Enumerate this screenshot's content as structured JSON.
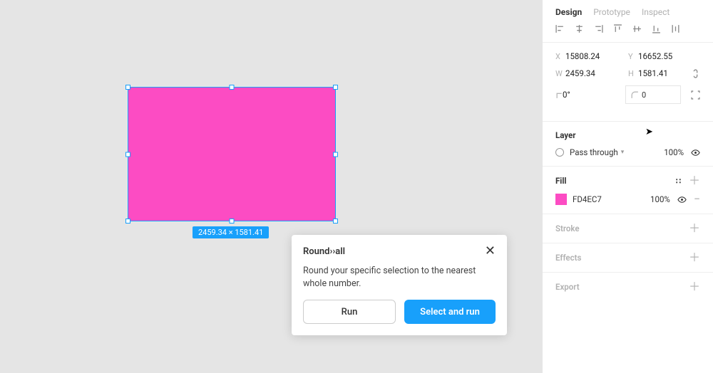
{
  "tabs": {
    "design": "Design",
    "prototype": "Prototype",
    "inspect": "Inspect"
  },
  "dims": {
    "xLabel": "X",
    "x": "15808.24",
    "yLabel": "Y",
    "y": "16652.55",
    "wLabel": "W",
    "w": "2459.34",
    "hLabel": "H",
    "h": "1581.41",
    "rotLabel": "⟀",
    "rot": "0°",
    "cornerLabel": "⌒",
    "corner": "0"
  },
  "sizeBadge": "2459.34 × 1581.41",
  "layer": {
    "title": "Layer",
    "blend": "Pass through",
    "opacity": "100%"
  },
  "fill": {
    "title": "Fill",
    "hex": "FD4EC7",
    "opacity": "100%"
  },
  "stroke": {
    "title": "Stroke"
  },
  "effects": {
    "title": "Effects"
  },
  "export": {
    "title": "Export"
  },
  "modal": {
    "title": "Round››all",
    "desc": "Round your specific selection to the nearest whole number.",
    "run": "Run",
    "selectRun": "Select and run"
  }
}
